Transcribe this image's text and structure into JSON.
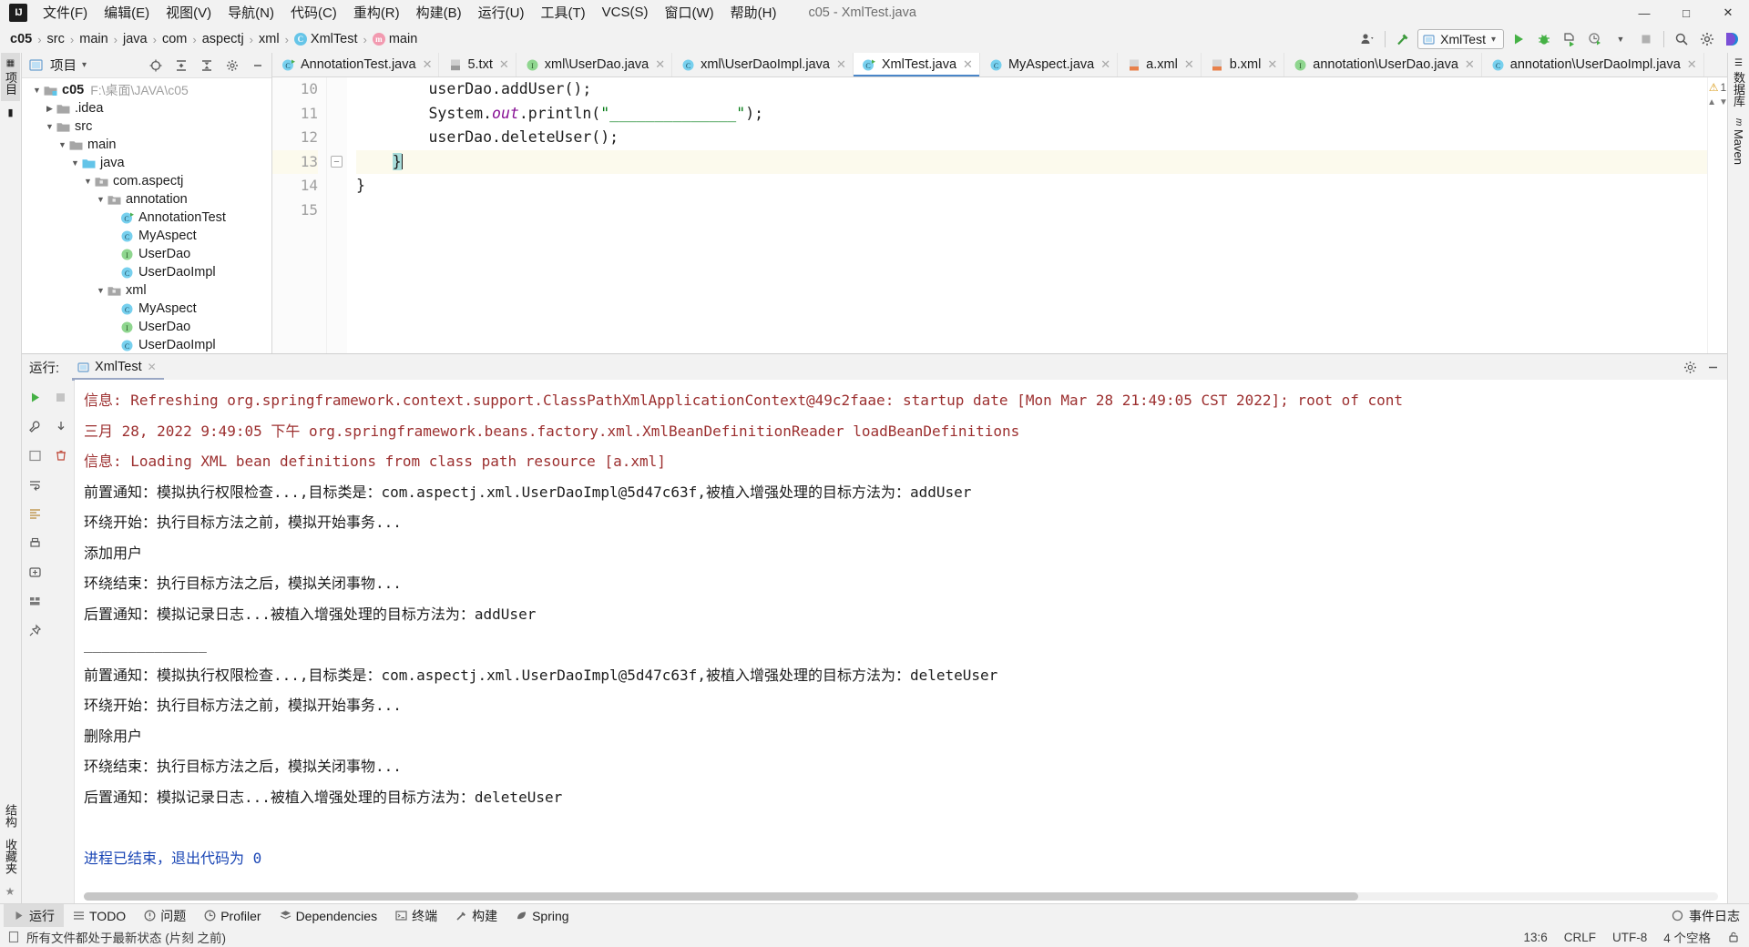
{
  "window": {
    "title": "c05 - XmlTest.java",
    "minimize": "—",
    "maximize": "□",
    "close": "✕"
  },
  "menu": {
    "items": [
      {
        "label": "文件(F)"
      },
      {
        "label": "编辑(E)"
      },
      {
        "label": "视图(V)"
      },
      {
        "label": "导航(N)"
      },
      {
        "label": "代码(C)"
      },
      {
        "label": "重构(R)"
      },
      {
        "label": "构建(B)"
      },
      {
        "label": "运行(U)"
      },
      {
        "label": "工具(T)"
      },
      {
        "label": "VCS(S)"
      },
      {
        "label": "窗口(W)"
      },
      {
        "label": "帮助(H)"
      }
    ]
  },
  "breadcrumb": {
    "items": [
      "c05",
      "src",
      "main",
      "java",
      "com",
      "aspectj",
      "xml",
      "XmlTest",
      "main"
    ],
    "separator": "›"
  },
  "run_config": {
    "name": "XmlTest",
    "caret": "▾"
  },
  "project_panel": {
    "title": "项目",
    "dropdown_caret": "▾",
    "tree": [
      {
        "depth": 0,
        "label": "c05",
        "path": "F:\\桌面\\JAVA\\c05",
        "icon": "module-folder",
        "arrow": "expanded",
        "bold": true
      },
      {
        "depth": 1,
        "label": ".idea",
        "icon": "folder",
        "arrow": "collapsed"
      },
      {
        "depth": 1,
        "label": "src",
        "icon": "folder",
        "arrow": "expanded"
      },
      {
        "depth": 2,
        "label": "main",
        "icon": "folder",
        "arrow": "expanded"
      },
      {
        "depth": 3,
        "label": "java",
        "icon": "source-folder",
        "arrow": "expanded"
      },
      {
        "depth": 4,
        "label": "com.aspectj",
        "icon": "package",
        "arrow": "expanded"
      },
      {
        "depth": 5,
        "label": "annotation",
        "icon": "package",
        "arrow": "expanded"
      },
      {
        "depth": 6,
        "label": "AnnotationTest",
        "icon": "class-runnable",
        "arrow": "none"
      },
      {
        "depth": 6,
        "label": "MyAspect",
        "icon": "class",
        "arrow": "none"
      },
      {
        "depth": 6,
        "label": "UserDao",
        "icon": "interface",
        "arrow": "none"
      },
      {
        "depth": 6,
        "label": "UserDaoImpl",
        "icon": "class",
        "arrow": "none"
      },
      {
        "depth": 5,
        "label": "xml",
        "icon": "package",
        "arrow": "expanded"
      },
      {
        "depth": 6,
        "label": "MyAspect",
        "icon": "class",
        "arrow": "none"
      },
      {
        "depth": 6,
        "label": "UserDao",
        "icon": "interface",
        "arrow": "none"
      },
      {
        "depth": 6,
        "label": "UserDaoImpl",
        "icon": "class",
        "arrow": "none"
      }
    ]
  },
  "editor": {
    "tabs": [
      {
        "label": "AnnotationTest.java",
        "icon": "class-runnable",
        "active": false
      },
      {
        "label": "5.txt",
        "icon": "text-file",
        "active": false
      },
      {
        "label": "xml\\UserDao.java",
        "icon": "interface",
        "active": false
      },
      {
        "label": "xml\\UserDaoImpl.java",
        "icon": "class",
        "active": false
      },
      {
        "label": "XmlTest.java",
        "icon": "class-runnable",
        "active": true
      },
      {
        "label": "MyAspect.java",
        "icon": "class",
        "active": false
      },
      {
        "label": "a.xml",
        "icon": "xml-file",
        "active": false
      },
      {
        "label": "b.xml",
        "icon": "xml-file",
        "active": false
      },
      {
        "label": "annotation\\UserDao.java",
        "icon": "interface",
        "active": false
      },
      {
        "label": "annotation\\UserDaoImpl.java",
        "icon": "class",
        "active": false
      }
    ],
    "close_glyph": "✕",
    "lines": [
      {
        "no": "10",
        "text": "        userDao.addUser();"
      },
      {
        "no": "11",
        "text": "        System.out.println(\"______________\");"
      },
      {
        "no": "12",
        "text": "        userDao.deleteUser();"
      },
      {
        "no": "13",
        "text": "    }",
        "current": true
      },
      {
        "no": "14",
        "text": "}"
      },
      {
        "no": "15",
        "text": ""
      }
    ],
    "code_parts": {
      "l10": "        userDao.addUser();",
      "l11_a": "        System.",
      "l11_field": "out",
      "l11_b": ".println(",
      "l11_str": "\"______________\"",
      "l11_c": ");",
      "l12": "        userDao.deleteUser();",
      "l13_indent": "    ",
      "l13_brace": "}",
      "l14": "}"
    },
    "warning_count": "1",
    "warning_glyph": "⚠",
    "fold_glyph": "−"
  },
  "run_panel": {
    "label": "运行:",
    "tab_label": "XmlTest",
    "tab_close": "✕",
    "console_lines": [
      {
        "text": "信息: Refreshing org.springframework.context.support.ClassPathXmlApplicationContext@49c2faae: startup date [Mon Mar 28 21:49:05 CST 2022]; root of cont",
        "color": "red"
      },
      {
        "text": "三月 28, 2022 9:49:05 下午 org.springframework.beans.factory.xml.XmlBeanDefinitionReader loadBeanDefinitions",
        "color": "red"
      },
      {
        "text": "信息: Loading XML bean definitions from class path resource [a.xml]",
        "color": "red"
      },
      {
        "text": "前置通知：模拟执行权限检查...,目标类是：com.aspectj.xml.UserDaoImpl@5d47c63f,被植入增强处理的目标方法为：addUser",
        "color": "black"
      },
      {
        "text": "环绕开始：执行目标方法之前，模拟开始事务...",
        "color": "black"
      },
      {
        "text": "添加用户",
        "color": "black"
      },
      {
        "text": "环绕结束：执行目标方法之后，模拟关闭事物...",
        "color": "black"
      },
      {
        "text": "后置通知：模拟记录日志...被植入增强处理的目标方法为：addUser",
        "color": "black"
      },
      {
        "text": "______________",
        "color": "black"
      },
      {
        "text": "前置通知：模拟执行权限检查...,目标类是：com.aspectj.xml.UserDaoImpl@5d47c63f,被植入增强处理的目标方法为：deleteUser",
        "color": "black"
      },
      {
        "text": "环绕开始：执行目标方法之前，模拟开始事务...",
        "color": "black"
      },
      {
        "text": "删除用户",
        "color": "black"
      },
      {
        "text": "环绕结束：执行目标方法之后，模拟关闭事物...",
        "color": "black"
      },
      {
        "text": "后置通知：模拟记录日志...被植入增强处理的目标方法为：deleteUser",
        "color": "black"
      },
      {
        "text": "",
        "color": "black"
      },
      {
        "text": "进程已结束，退出代码为 0",
        "color": "blue"
      }
    ]
  },
  "left_strip": {
    "items": [
      {
        "label": "项目",
        "selected": true
      },
      {
        "label": "",
        "selected": false
      }
    ]
  },
  "left_strip_bottom": {
    "items": [
      {
        "label": "结构"
      },
      {
        "label": "收藏夹"
      }
    ]
  },
  "right_strip": {
    "items": [
      {
        "label": "数据库"
      },
      {
        "label": "Maven"
      }
    ]
  },
  "tool_windows": {
    "items": [
      {
        "label": "运行",
        "icon": "play-icon",
        "selected": true
      },
      {
        "label": "TODO",
        "icon": "list-icon",
        "selected": false
      },
      {
        "label": "问题",
        "icon": "error-icon",
        "selected": false
      },
      {
        "label": "Profiler",
        "icon": "profiler-icon",
        "selected": false
      },
      {
        "label": "Dependencies",
        "icon": "layers-icon",
        "selected": false
      },
      {
        "label": "终端",
        "icon": "terminal-icon",
        "selected": false
      },
      {
        "label": "构建",
        "icon": "hammer-icon",
        "selected": false
      },
      {
        "label": "Spring",
        "icon": "spring-leaf-icon",
        "selected": false
      }
    ],
    "event_log": "事件日志"
  },
  "status_bar": {
    "message": "所有文件都处于最新状态 (片刻 之前)",
    "caret_position": "13:6",
    "line_separator": "CRLF",
    "encoding": "UTF-8",
    "indent": "4 个空格"
  },
  "colors": {
    "accent_blue": "#4a86c8",
    "console_red": "#9c2f2f",
    "console_blue": "#1a46b5",
    "string_green": "#067d17",
    "field_purple": "#871094",
    "run_green": "#4caf50"
  }
}
